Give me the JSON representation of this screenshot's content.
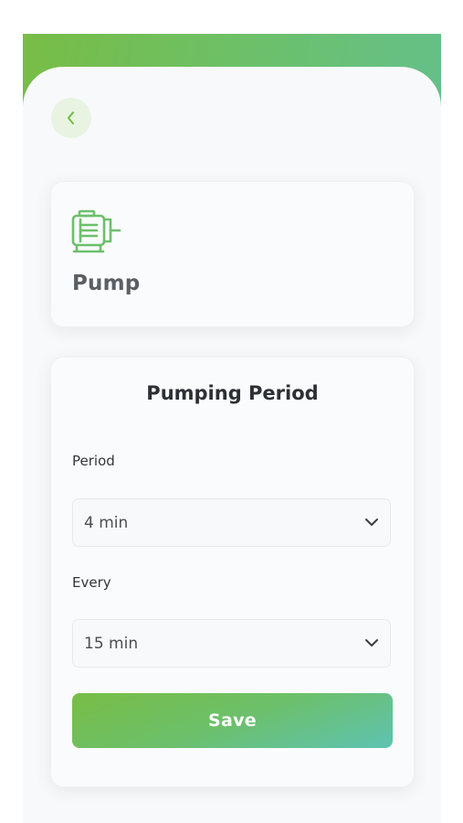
{
  "device": {
    "name": "Pump",
    "icon": "motor-pump-icon"
  },
  "header": {
    "back_icon": "chevron-left-icon"
  },
  "pumping_period": {
    "title": "Pumping Period",
    "period": {
      "label": "Period",
      "value": "4 min"
    },
    "every": {
      "label": "Every",
      "value": "15 min"
    },
    "save_label": "Save"
  },
  "colors": {
    "accent_green": "#78bd45",
    "accent_teal": "#5ec3b2",
    "back_button_bg": "#e8f3e2"
  }
}
